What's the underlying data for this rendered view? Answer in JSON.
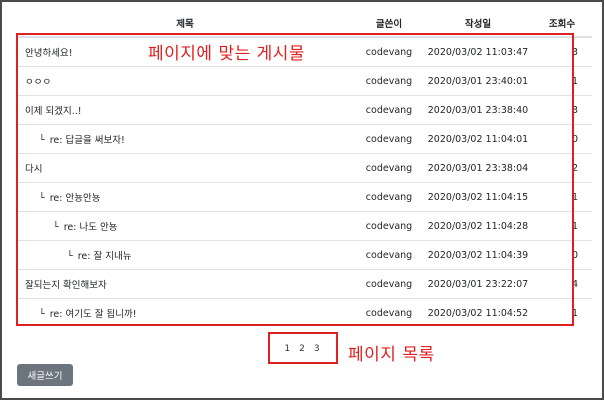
{
  "table": {
    "headers": {
      "title": "제목",
      "writer": "글쓴이",
      "date": "작성일",
      "hits": "조회수"
    },
    "rows": [
      {
        "title": "안녕하세요!",
        "reply": false,
        "depth": 0,
        "writer": "codevang",
        "date": "2020/03/02 11:03:47",
        "hits": "3"
      },
      {
        "title": "ㅇㅇㅇ",
        "reply": false,
        "depth": 0,
        "writer": "codevang",
        "date": "2020/03/01 23:40:01",
        "hits": "1"
      },
      {
        "title": "이제 되겠지..!",
        "reply": false,
        "depth": 0,
        "writer": "codevang",
        "date": "2020/03/01 23:38:40",
        "hits": "3"
      },
      {
        "title": "re:  답글을 써보자!",
        "reply": true,
        "depth": 1,
        "writer": "codevang",
        "date": "2020/03/02 11:04:01",
        "hits": "0"
      },
      {
        "title": "다시",
        "reply": false,
        "depth": 0,
        "writer": "codevang",
        "date": "2020/03/01 23:38:04",
        "hits": "2"
      },
      {
        "title": "re:  안뇽안뇽",
        "reply": true,
        "depth": 1,
        "writer": "codevang",
        "date": "2020/03/02 11:04:15",
        "hits": "1"
      },
      {
        "title": "re:  나도 안뇽",
        "reply": true,
        "depth": 2,
        "writer": "codevang",
        "date": "2020/03/02 11:04:28",
        "hits": "1"
      },
      {
        "title": "re:  잘 지내뉴",
        "reply": true,
        "depth": 3,
        "writer": "codevang",
        "date": "2020/03/02 11:04:39",
        "hits": "0"
      },
      {
        "title": "잘되는지 확인해보자",
        "reply": false,
        "depth": 0,
        "writer": "codevang",
        "date": "2020/03/01 23:22:07",
        "hits": "4"
      },
      {
        "title": "re:  여기도 잘 됩니까!",
        "reply": true,
        "depth": 1,
        "writer": "codevang",
        "date": "2020/03/02 11:04:52",
        "hits": "1"
      }
    ]
  },
  "annotations": {
    "list_label": "페이지에 맞는 게시물",
    "pages_label": "페이지 목록"
  },
  "pagination": [
    "1",
    "2",
    "3"
  ],
  "write_button": "새글쓰기",
  "reply_marker": "└",
  "colors": {
    "annotation_red": "#e02020",
    "button_gray": "#6c757d",
    "row_border": "#dee2e6"
  }
}
